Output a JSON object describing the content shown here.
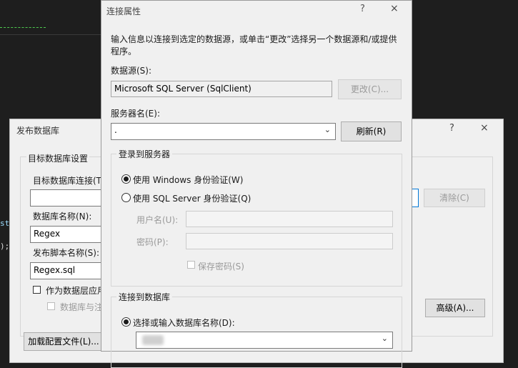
{
  "editor": {
    "code_fragment_1": "st",
    "code_fragment_2": ");"
  },
  "publish_dialog": {
    "title": "发布数据库",
    "help": "?",
    "close": "×",
    "group_label": "目标数据库设置",
    "connection_label": "目标数据库连接(T",
    "db_name_label": "数据库名称(N):",
    "db_name_value": "Regex",
    "script_name_label": "发布脚本名称(S):",
    "script_name_value": "Regex.sql",
    "dac_checkbox_label": "作为数据层应用",
    "dac_sub_checkbox_label": "数据库与注",
    "clear_button": "清除(C)",
    "advanced_button": "高级(A)...",
    "load_profile_button": "加载配置文件(L)..."
  },
  "connection_dialog": {
    "title": "连接属性",
    "help": "?",
    "close": "×",
    "description": "输入信息以连接到选定的数据源，或单击“更改”选择另一个数据源和/或提供程序。",
    "datasource_label": "数据源(S):",
    "datasource_value": "Microsoft SQL Server (SqlClient)",
    "change_button": "更改(C)...",
    "server_label": "服务器名(E):",
    "server_value": ".",
    "refresh_button": "刷新(R)",
    "login_group": "登录到服务器",
    "windows_auth": "使用 Windows 身份验证(W)",
    "sql_auth": "使用 SQL Server 身份验证(Q)",
    "username_label": "用户名(U):",
    "password_label": "密码(P):",
    "save_password": "保存密码(S)",
    "connect_group": "连接到数据库",
    "select_db_option": "选择或输入数据库名称(D):"
  }
}
